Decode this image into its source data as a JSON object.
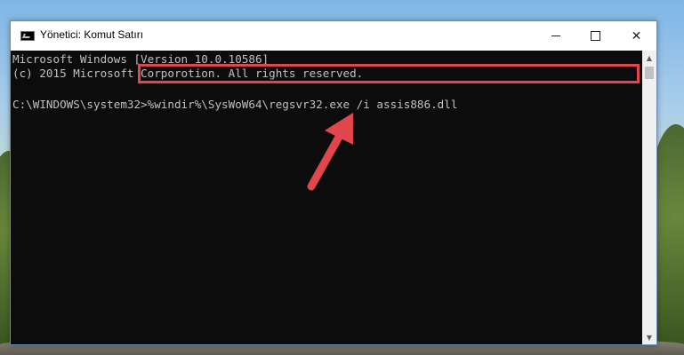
{
  "window": {
    "title": "Yönetici: Komut Satırı",
    "app_icon": "cmd-icon",
    "controls": {
      "minimize": "minimize-icon",
      "maximize": "maximize-icon",
      "close_glyph": "✕"
    }
  },
  "console": {
    "lines": [
      "Microsoft Windows [Version 10.0.10586]",
      "(c) 2015 Microsoft Corporotion. All rights reserved.",
      "",
      "C:\\WINDOWS\\system32>%windir%\\SysWoW64\\regsvr32.exe /i assis886.dll"
    ]
  },
  "annotation": {
    "highlight_color": "#e0464b",
    "arrow_color": "#e0464b"
  },
  "scrollbar": {
    "up_glyph": "▲",
    "down_glyph": "▼"
  }
}
